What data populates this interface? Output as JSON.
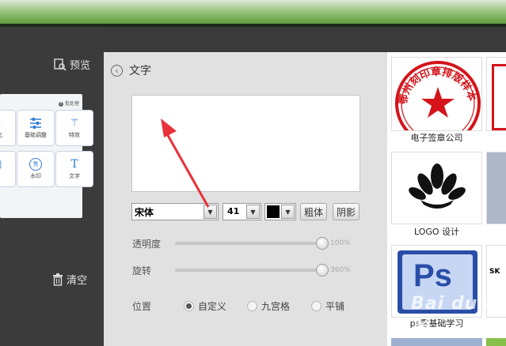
{
  "toolbar": {
    "preview_label": "预览",
    "clear_label": "清空"
  },
  "thumbnail": {
    "hint": "批处理",
    "tools": [
      {
        "label": "优化",
        "icon": "magic-icon"
      },
      {
        "label": "基础调整",
        "icon": "sliders-icon"
      },
      {
        "label": "特效",
        "icon": "wand-icon"
      },
      {
        "label": "框",
        "icon": "frame-icon"
      },
      {
        "label": "水印",
        "icon": "watermark-icon"
      },
      {
        "label": "文字",
        "icon": "text-icon"
      }
    ]
  },
  "panel": {
    "title": "文字",
    "text_value": "",
    "font": {
      "value": "宋体"
    },
    "size": {
      "value": "41"
    },
    "color": {
      "value": "#000000"
    },
    "bold_label": "粗体",
    "shadow_label": "阴影",
    "opacity": {
      "label": "透明度",
      "value_text": "100%",
      "value": 100
    },
    "rotation": {
      "label": "旋转",
      "value_text": "360%",
      "value": 360
    },
    "position": {
      "label": "位置",
      "options": [
        {
          "label": "自定义",
          "selected": true
        },
        {
          "label": "九宫格",
          "selected": false
        },
        {
          "label": "平铺",
          "selected": false
        }
      ]
    }
  },
  "templates": {
    "items": [
      {
        "caption": "电子签章公司",
        "seal_text": "鄂州刻印章排版样本章"
      },
      {
        "caption": "LOGO 设计"
      },
      {
        "caption": "ps零基础学习",
        "logo": "Ps"
      }
    ],
    "side_badges": [
      "SK"
    ]
  },
  "watermark": "Bai du 经验",
  "colors": {
    "accent": "#2f7bd6",
    "seal_red": "#d4141a",
    "ps_blue": "#2a4ea8"
  }
}
